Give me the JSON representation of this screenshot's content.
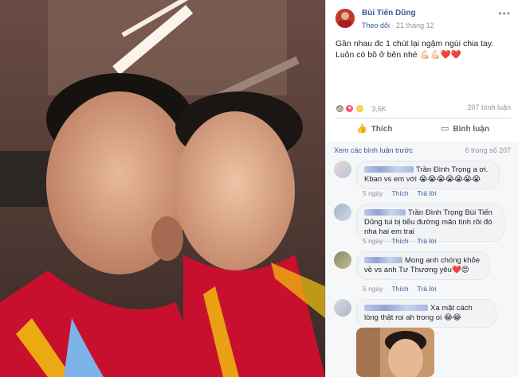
{
  "post": {
    "author": "Bùi Tiến Dũng",
    "follow_label": "Theo dõi",
    "date": "21 tháng 12",
    "caption": "Gần nhau đc 1 chút lại ngậm ngùi chia tay. Luôn có bồ ở bên nhé 💪🏻💪🏻❤️❤️",
    "more_icon": "more-horizontal-icon"
  },
  "reactions": {
    "count": "3,6K",
    "comments_count": "207 bình luận"
  },
  "actions": {
    "like_label": "Thích",
    "comment_label": "Bình luận"
  },
  "comments_section": {
    "view_previous": "Xem các bình luận trước",
    "shown_count": "6 trong số 207"
  },
  "comments": [
    {
      "text": "Trần Đình Trọng a ơi. Kban vs em với 😭😭😭😭😭😭😭",
      "time": "5 ngày",
      "like": "Thích",
      "reply": "Trả lời"
    },
    {
      "text": "Trần Đình Trọng Bùi Tiến Dũng tui bị tiểu đường mãn tính rồi đó nha hai em trai",
      "time": "5 ngày",
      "like": "Thích",
      "reply": "Trả lời"
    },
    {
      "text": "Mong anh chóng khỏe về vs anh Tư Thương yêu❤️😍",
      "time": "5 ngày",
      "like": "Thích",
      "reply": "Trả lời"
    },
    {
      "text": "Xa mặt cách lòng thật roi ah trong oi 😂😂",
      "time": "",
      "like": "",
      "reply": ""
    }
  ],
  "colors": {
    "link": "#385898",
    "secondary_text": "#90949c",
    "jacket_red": "#c8102e"
  }
}
